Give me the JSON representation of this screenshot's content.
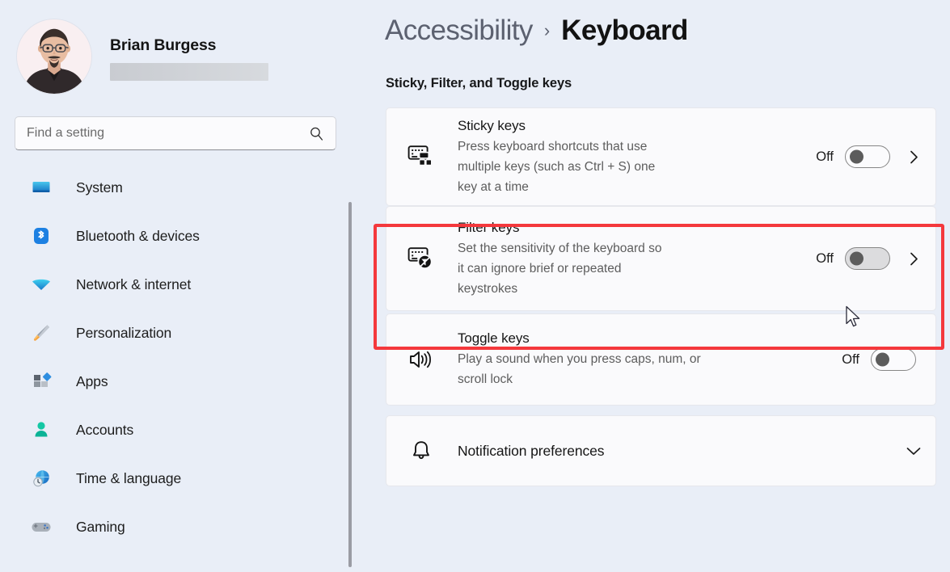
{
  "profile": {
    "name": "Brian Burgess",
    "email_redacted": true,
    "avatar_name": "user-avatar"
  },
  "search": {
    "placeholder": "Find a setting",
    "value": "",
    "icon": "search-icon"
  },
  "sidebar": {
    "items": [
      {
        "label": "System",
        "icon": "monitor-icon"
      },
      {
        "label": "Bluetooth & devices",
        "icon": "bluetooth-icon"
      },
      {
        "label": "Network & internet",
        "icon": "wifi-icon"
      },
      {
        "label": "Personalization",
        "icon": "paintbrush-icon"
      },
      {
        "label": "Apps",
        "icon": "apps-icon"
      },
      {
        "label": "Accounts",
        "icon": "person-icon"
      },
      {
        "label": "Time & language",
        "icon": "clock-globe-icon"
      },
      {
        "label": "Gaming",
        "icon": "gamepad-icon"
      }
    ]
  },
  "header": {
    "breadcrumb_parent": "Accessibility",
    "breadcrumb_separator": "›",
    "breadcrumb_current": "Keyboard",
    "section_title": "Sticky, Filter, and Toggle keys"
  },
  "cards": [
    {
      "title": "Sticky keys",
      "description": "Press keyboard shortcuts that use multiple keys (such as Ctrl + S) one key at a time",
      "state_label": "Off",
      "toggle_on": false,
      "toggle_hovered": false,
      "has_chevron": true,
      "chevron": "chevron-right-icon",
      "icon": "sticky-keys-icon"
    },
    {
      "title": "Filter keys",
      "description": "Set the sensitivity of the keyboard so it can ignore brief or repeated keystrokes",
      "state_label": "Off",
      "toggle_on": false,
      "toggle_hovered": true,
      "has_chevron": true,
      "chevron": "chevron-right-icon",
      "icon": "filter-keys-icon",
      "highlighted": true
    },
    {
      "title": "Toggle keys",
      "description": "Play a sound when you press caps, num, or scroll lock",
      "state_label": "Off",
      "toggle_on": false,
      "toggle_hovered": false,
      "has_chevron": false,
      "icon": "speaker-icon"
    }
  ],
  "notification_card": {
    "title": "Notification preferences",
    "icon": "bell-icon",
    "chevron": "chevron-down-icon"
  },
  "annotation": {
    "highlight_color": "#f4383c",
    "cursor": "arrow-cursor"
  },
  "colors": {
    "page_background": "#e9eef7",
    "card_background": "#fafafc",
    "accent_red": "#f4383c",
    "text_primary": "#161616",
    "text_secondary": "#5d5d5d"
  }
}
